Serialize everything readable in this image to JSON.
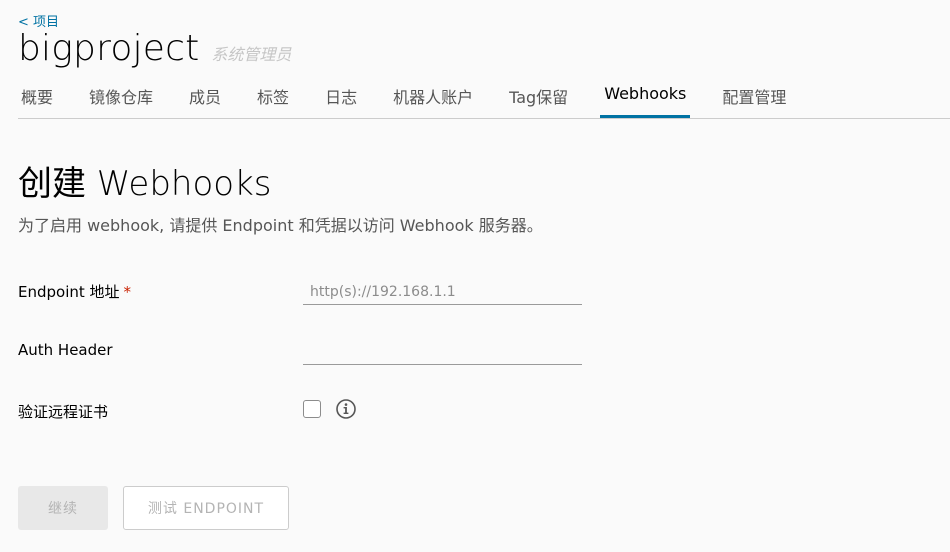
{
  "breadcrumb": {
    "back_label": "< 项目"
  },
  "header": {
    "project_name": "bigproject",
    "role": "系统管理员"
  },
  "tabs": [
    {
      "label": "概要"
    },
    {
      "label": "镜像仓库"
    },
    {
      "label": "成员"
    },
    {
      "label": "标签"
    },
    {
      "label": "日志"
    },
    {
      "label": "机器人账户"
    },
    {
      "label": "Tag保留"
    },
    {
      "label": "Webhooks",
      "active": true
    },
    {
      "label": "配置管理"
    }
  ],
  "main": {
    "title": "创建 Webhooks",
    "description": "为了启用 webhook, 请提供 Endpoint 和凭据以访问 Webhook 服务器。"
  },
  "form": {
    "endpoint": {
      "label": "Endpoint 地址",
      "required_mark": "*",
      "value": "",
      "placeholder": "http(s)://192.168.1.1"
    },
    "auth_header": {
      "label": "Auth Header",
      "value": "",
      "placeholder": ""
    },
    "verify_cert": {
      "label": "验证远程证书",
      "checked": false,
      "info_icon": "info-circle-icon"
    }
  },
  "buttons": {
    "continue_label": "继续",
    "test_endpoint_label": "测试 ENDPOINT"
  },
  "colors": {
    "accent": "#0072a3",
    "required": "#c92100",
    "background": "#fafafa"
  }
}
